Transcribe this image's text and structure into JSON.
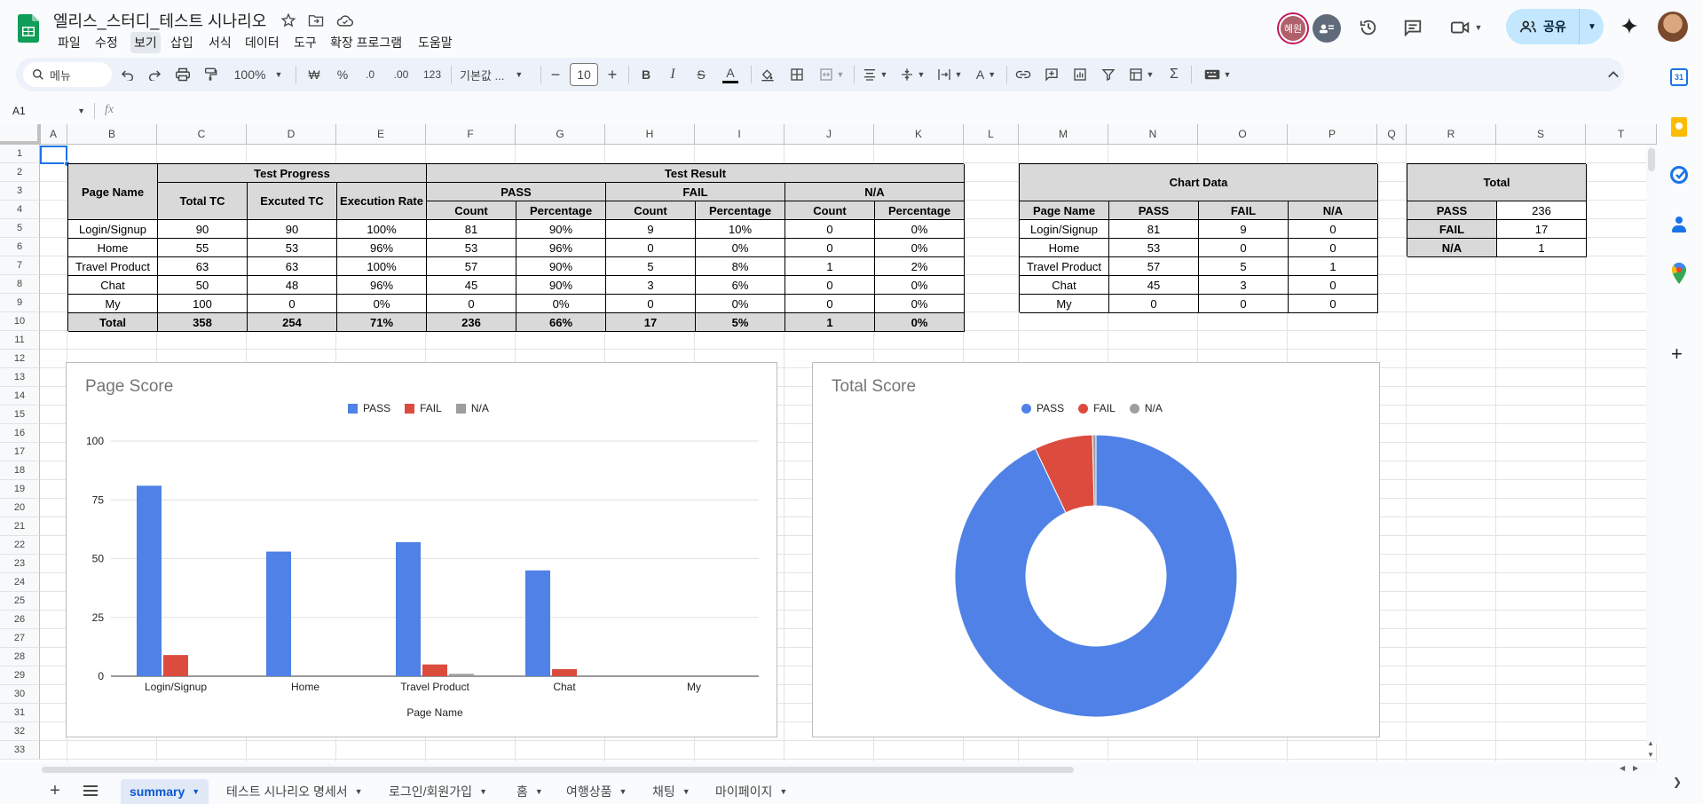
{
  "doc": {
    "title": "엘리스_스터디_테스트 시나리오"
  },
  "menu": [
    "파일",
    "수정",
    "보기",
    "삽입",
    "서식",
    "데이터",
    "도구",
    "확장 프로그램",
    "도움말"
  ],
  "menu_active_index": 2,
  "header": {
    "user_badge": "혜원",
    "share_label": "공유"
  },
  "toolbar": {
    "search_placeholder": "메뉴",
    "zoom": "100%",
    "currency": "₩",
    "percent": "%",
    "dec_less": ".0",
    "dec_more": ".00",
    "number_format": "123",
    "font": "기본값 ...",
    "font_size": "10"
  },
  "formula": {
    "cell_ref": "A1",
    "fx": "fx",
    "value": ""
  },
  "columns": [
    "A",
    "B",
    "C",
    "D",
    "E",
    "F",
    "G",
    "H",
    "I",
    "J",
    "K",
    "L",
    "M",
    "N",
    "O",
    "P",
    "Q",
    "R",
    "S",
    "T"
  ],
  "rows": [
    "1",
    "2",
    "3",
    "4",
    "5",
    "6",
    "7",
    "8",
    "9",
    "10",
    "11",
    "12",
    "13",
    "14",
    "15",
    "16",
    "17",
    "18",
    "19",
    "20",
    "21",
    "22",
    "23",
    "24",
    "25",
    "26",
    "27",
    "28",
    "29",
    "30",
    "31",
    "32",
    "33"
  ],
  "main_table": {
    "page_name": "Page Name",
    "test_progress": "Test Progress",
    "test_result": "Test Result",
    "total_tc": "Total TC",
    "excuted_tc": "Excuted TC",
    "execution_rate": "Execution Rate",
    "pass": "PASS",
    "fail": "FAIL",
    "na": "N/A",
    "count": "Count",
    "percentage": "Percentage",
    "rows": [
      [
        "Login/Signup",
        "90",
        "90",
        "100%",
        "81",
        "90%",
        "9",
        "10%",
        "0",
        "0%"
      ],
      [
        "Home",
        "55",
        "53",
        "96%",
        "53",
        "96%",
        "0",
        "0%",
        "0",
        "0%"
      ],
      [
        "Travel Product",
        "63",
        "63",
        "100%",
        "57",
        "90%",
        "5",
        "8%",
        "1",
        "2%"
      ],
      [
        "Chat",
        "50",
        "48",
        "96%",
        "45",
        "90%",
        "3",
        "6%",
        "0",
        "0%"
      ],
      [
        "My",
        "100",
        "0",
        "0%",
        "0",
        "0%",
        "0",
        "0%",
        "0",
        "0%"
      ]
    ],
    "total": [
      "Total",
      "358",
      "254",
      "71%",
      "236",
      "66%",
      "17",
      "5%",
      "1",
      "0%"
    ]
  },
  "chart_table": {
    "title": "Chart Data",
    "headers": [
      "Page Name",
      "PASS",
      "FAIL",
      "N/A"
    ],
    "rows": [
      [
        "Login/Signup",
        "81",
        "9",
        "0"
      ],
      [
        "Home",
        "53",
        "0",
        "0"
      ],
      [
        "Travel Product",
        "57",
        "5",
        "1"
      ],
      [
        "Chat",
        "45",
        "3",
        "0"
      ],
      [
        "My",
        "0",
        "0",
        "0"
      ]
    ]
  },
  "total_table": {
    "title": "Total",
    "rows": [
      [
        "PASS",
        "236"
      ],
      [
        "FAIL",
        "17"
      ],
      [
        "N/A",
        "1"
      ]
    ]
  },
  "chart_data": [
    {
      "type": "bar",
      "title": "Page Score",
      "xlabel": "Page Name",
      "ylabel": "",
      "categories": [
        "Login/Signup",
        "Home",
        "Travel Product",
        "Chat",
        "My"
      ],
      "series": [
        {
          "name": "PASS",
          "color": "#4f81e6",
          "values": [
            81,
            53,
            57,
            45,
            0
          ]
        },
        {
          "name": "FAIL",
          "color": "#db4c3f",
          "values": [
            9,
            0,
            5,
            3,
            0
          ]
        },
        {
          "name": "N/A",
          "color": "#9e9e9e",
          "values": [
            0,
            0,
            1,
            0,
            0
          ]
        }
      ],
      "yticks": [
        "0",
        "25",
        "50",
        "75",
        "100"
      ],
      "ylim": [
        0,
        100
      ],
      "legend": "top",
      "grid": true
    },
    {
      "type": "pie",
      "title": "Total Score",
      "donut": true,
      "labels": [
        "PASS",
        "FAIL",
        "N/A"
      ],
      "values": [
        236,
        17,
        1
      ],
      "colors": [
        "#4f81e6",
        "#db4c3f",
        "#9e9e9e"
      ],
      "legend": "top"
    }
  ],
  "tabs": [
    {
      "label": "summary",
      "active": true
    },
    {
      "label": "테스트 시나리오 명세서"
    },
    {
      "label": "로그인/회원가입"
    },
    {
      "label": "홈"
    },
    {
      "label": "여행상품"
    },
    {
      "label": "채팅"
    },
    {
      "label": "마이페이지"
    }
  ],
  "side_panel": [
    "calendar-icon",
    "keep-icon",
    "tasks-icon",
    "contacts-icon",
    "maps-icon",
    "add-icon"
  ]
}
